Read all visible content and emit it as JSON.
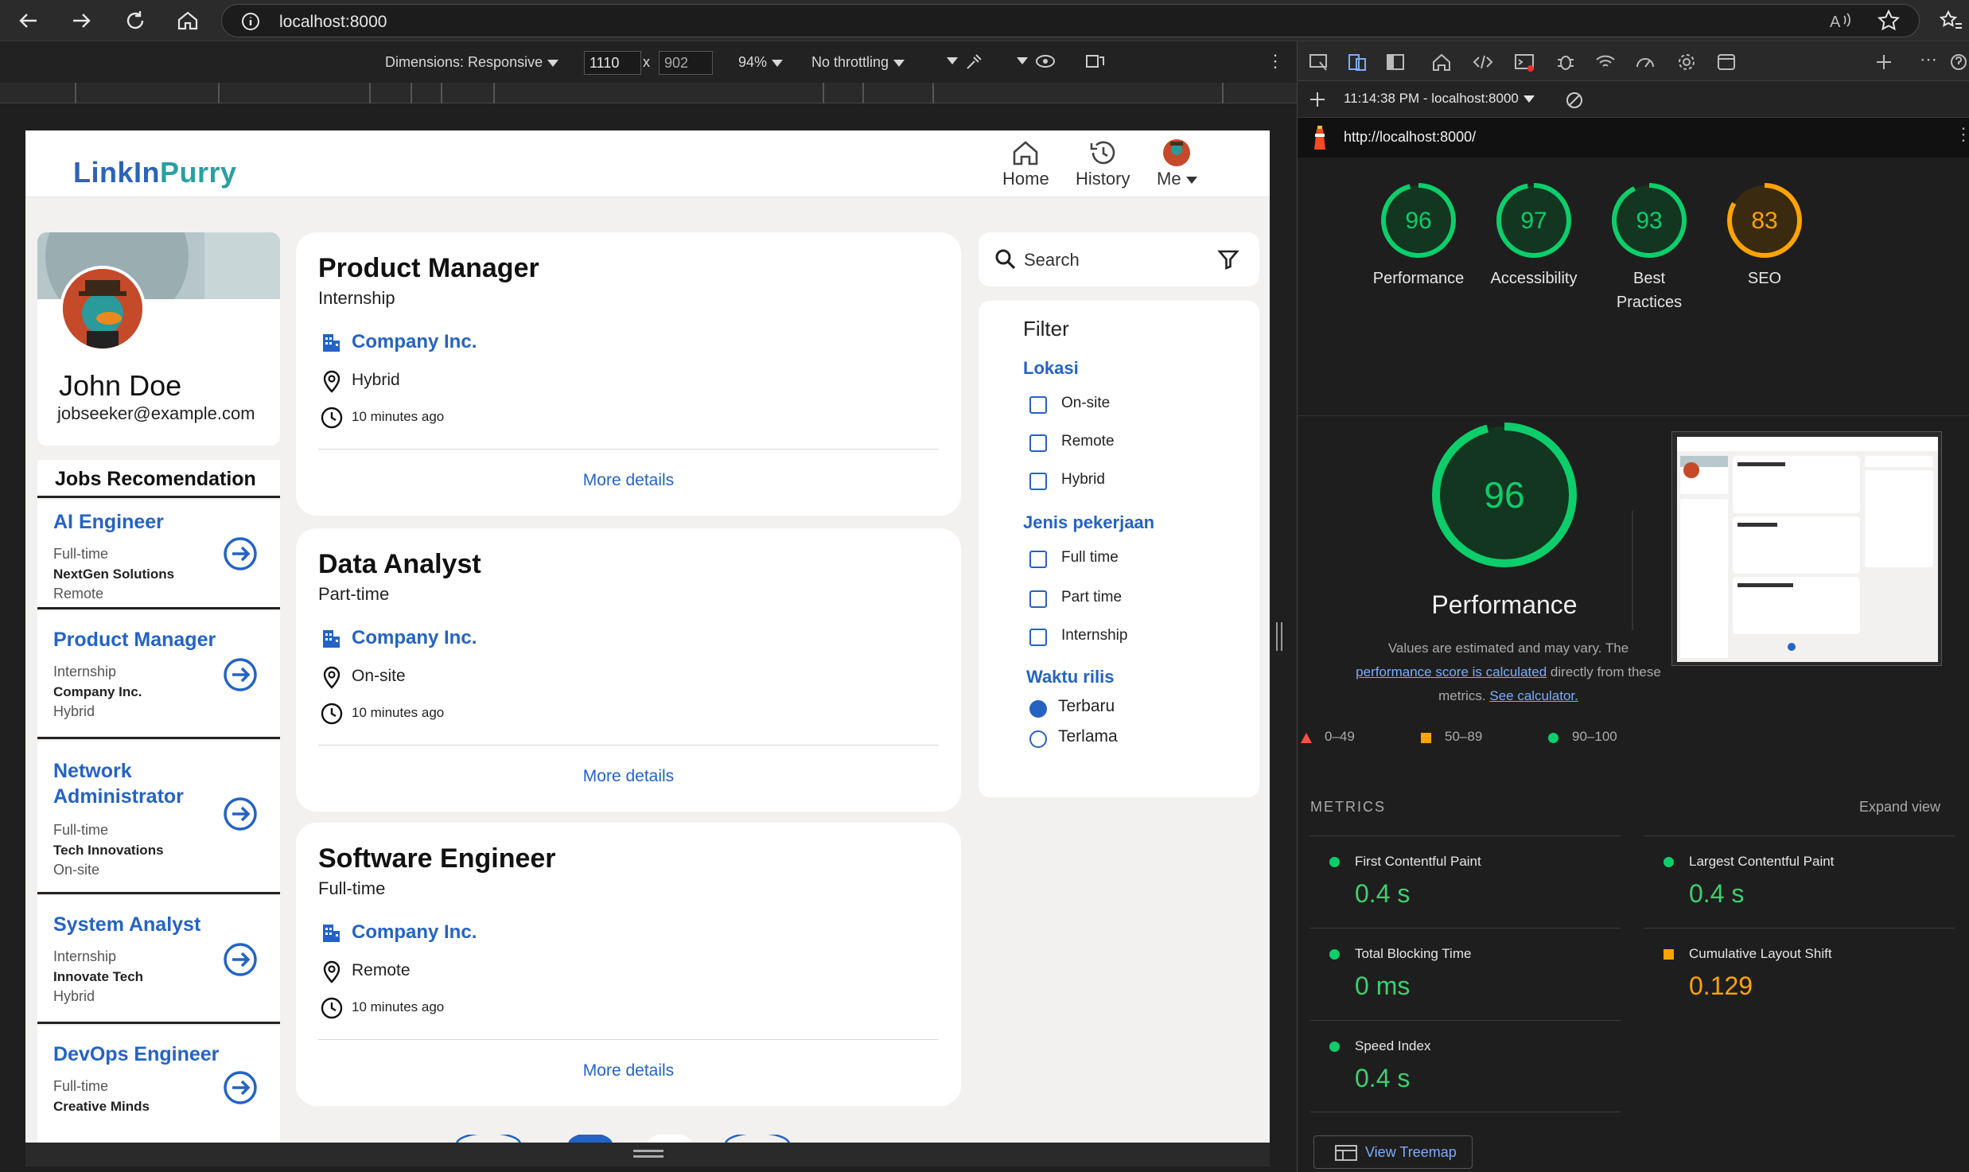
{
  "browser": {
    "url": "localhost:8000"
  },
  "device_toolbar": {
    "dimensions_label": "Dimensions: Responsive",
    "width": "1110",
    "times": "x",
    "height": "902",
    "zoom": "94%",
    "throttling": "No throttling"
  },
  "site": {
    "logo_left": "LinkIn",
    "logo_right": "Purry",
    "nav": {
      "home": "Home",
      "history": "History",
      "me": "Me"
    },
    "profile": {
      "name": "John Doe",
      "email": "jobseeker@example.com"
    },
    "recommendation_title": "Jobs Recomendation",
    "recommendations": [
      {
        "title": "AI Engineer",
        "type": "Full-time",
        "company": "NextGen Solutions",
        "location": "Remote"
      },
      {
        "title": "Product Manager",
        "type": "Internship",
        "company": "Company Inc.",
        "location": "Hybrid"
      },
      {
        "title_line1": "Network",
        "title_line2": "Administrator",
        "type": "Full-time",
        "company": "Tech Innovations",
        "location": "On-site"
      },
      {
        "title": "System Analyst",
        "type": "Internship",
        "company": "Innovate Tech",
        "location": "Hybrid"
      },
      {
        "title": "DevOps Engineer",
        "type": "Full-time",
        "company": "Creative Minds",
        "location": ""
      }
    ],
    "jobs": [
      {
        "title": "Product Manager",
        "type": "Internship",
        "company": "Company Inc.",
        "location": "Hybrid",
        "posted": "10 minutes ago",
        "more": "More details"
      },
      {
        "title": "Data Analyst",
        "type": "Part-time",
        "company": "Company Inc.",
        "location": "On-site",
        "posted": "10 minutes ago",
        "more": "More details"
      },
      {
        "title": "Software Engineer",
        "type": "Full-time",
        "company": "Company Inc.",
        "location": "Remote",
        "posted": "10 minutes ago",
        "more": "More details"
      }
    ],
    "search": {
      "label": "Search"
    },
    "filter": {
      "title": "Filter",
      "lokasi_title": "Lokasi",
      "lokasi": [
        "On-site",
        "Remote",
        "Hybrid"
      ],
      "jenis_title": "Jenis pekerjaan",
      "jenis": [
        "Full time",
        "Part time",
        "Internship"
      ],
      "waktu_title": "Waktu rilis",
      "waktu": [
        "Terbaru",
        "Terlama"
      ],
      "waktu_selected": "Terbaru"
    }
  },
  "devtools": {
    "timestamp": "11:14:38 PM - localhost:8000",
    "report_url": "http://localhost:8000/",
    "scores": [
      {
        "value": "96",
        "label": "Performance",
        "color": "#0cce6b"
      },
      {
        "value": "97",
        "label": "Accessibility",
        "color": "#0cce6b"
      },
      {
        "value": "93",
        "label_line1": "Best",
        "label_line2": "Practices",
        "color": "#0cce6b"
      },
      {
        "value": "83",
        "label": "SEO",
        "color": "#ffa400"
      }
    ],
    "big_score": "96",
    "big_title": "Performance",
    "note_1": "Values are estimated and may vary. The",
    "note_link_1": "performance score is calculated",
    "note_2": "directly from these",
    "note_3": "metrics.",
    "note_link_2": "See calculator.",
    "legend": [
      "0–49",
      "50–89",
      "90–100"
    ],
    "metrics_title": "METRICS",
    "expand": "Expand view",
    "metrics": [
      {
        "name": "First Contentful Paint",
        "value": "0.4 s",
        "status": "good"
      },
      {
        "name": "Largest Contentful Paint",
        "value": "0.4 s",
        "status": "good"
      },
      {
        "name": "Total Blocking Time",
        "value": "0 ms",
        "status": "good"
      },
      {
        "name": "Cumulative Layout Shift",
        "value": "0.129",
        "status": "average"
      },
      {
        "name": "Speed Index",
        "value": "0.4 s",
        "status": "good"
      }
    ],
    "treemap": "View Treemap"
  }
}
